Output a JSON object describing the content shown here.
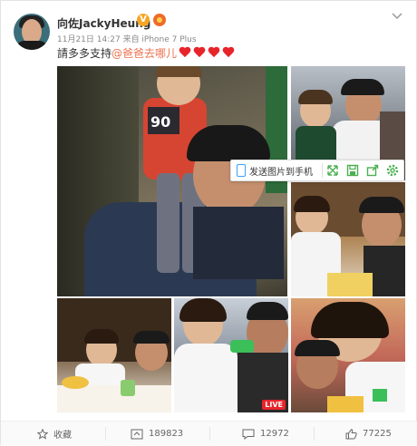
{
  "post": {
    "author_name": "向佐JackyHeung",
    "verified_badge": "V",
    "meta_text": "11月21日 14:27 来自 iPhone 7 Plus",
    "text_prefix": "請多多支持",
    "mention": "@爸爸去哪儿",
    "hearts_count": 4
  },
  "image_toolbar": {
    "send_label": "发送图片到手机",
    "icons": [
      "expand-icon",
      "save-icon",
      "share-icon",
      "settings-icon"
    ]
  },
  "images": [
    {
      "name": "photo-1",
      "live": false
    },
    {
      "name": "photo-2",
      "live": false
    },
    {
      "name": "photo-3",
      "live": false
    },
    {
      "name": "photo-4",
      "live": false
    },
    {
      "name": "photo-5",
      "live": true,
      "live_label": "LIVE"
    },
    {
      "name": "photo-6",
      "live": false
    }
  ],
  "actions": {
    "favorite_label": "收藏",
    "repost_count": "189823",
    "comment_count": "12972",
    "like_count": "77225"
  },
  "colors": {
    "accent": "#eb7350",
    "heart": "#e8242b",
    "live_badge": "#e8242b",
    "verified": "#f5a623"
  }
}
